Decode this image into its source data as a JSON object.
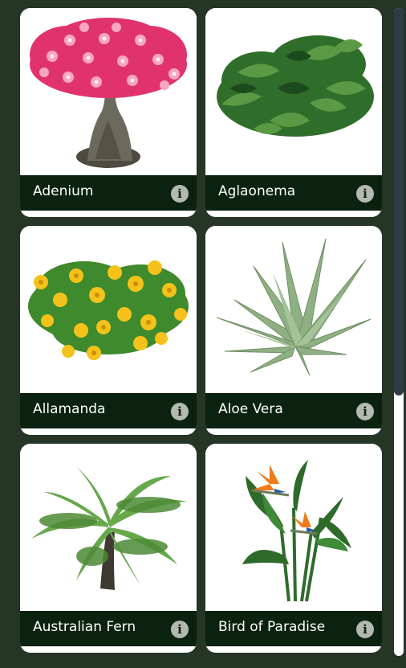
{
  "plants": [
    {
      "name": "Adenium",
      "image_icon": "adenium-flowering-bonsai",
      "info_icon": "info-icon",
      "info_glyph": "i"
    },
    {
      "name": "Aglaonema",
      "image_icon": "aglaonema-foliage",
      "info_icon": "info-icon",
      "info_glyph": "i"
    },
    {
      "name": "Allamanda",
      "image_icon": "allamanda-yellow-flowers",
      "info_icon": "info-icon",
      "info_glyph": "i"
    },
    {
      "name": "Aloe Vera",
      "image_icon": "aloe-vera-succulent",
      "info_icon": "info-icon",
      "info_glyph": "i"
    },
    {
      "name": "Australian Fern",
      "image_icon": "tree-fern",
      "info_icon": "info-icon",
      "info_glyph": "i"
    },
    {
      "name": "Bird of Paradise",
      "image_icon": "bird-of-paradise-flower",
      "info_icon": "info-icon",
      "info_glyph": "i"
    }
  ],
  "colors": {
    "background": "#253526",
    "card": "#ffffff",
    "footer": "#0b2210",
    "label": "#ffffff",
    "info_button": "#b4b8b2",
    "scroll_thumb": "#2f3b47"
  }
}
